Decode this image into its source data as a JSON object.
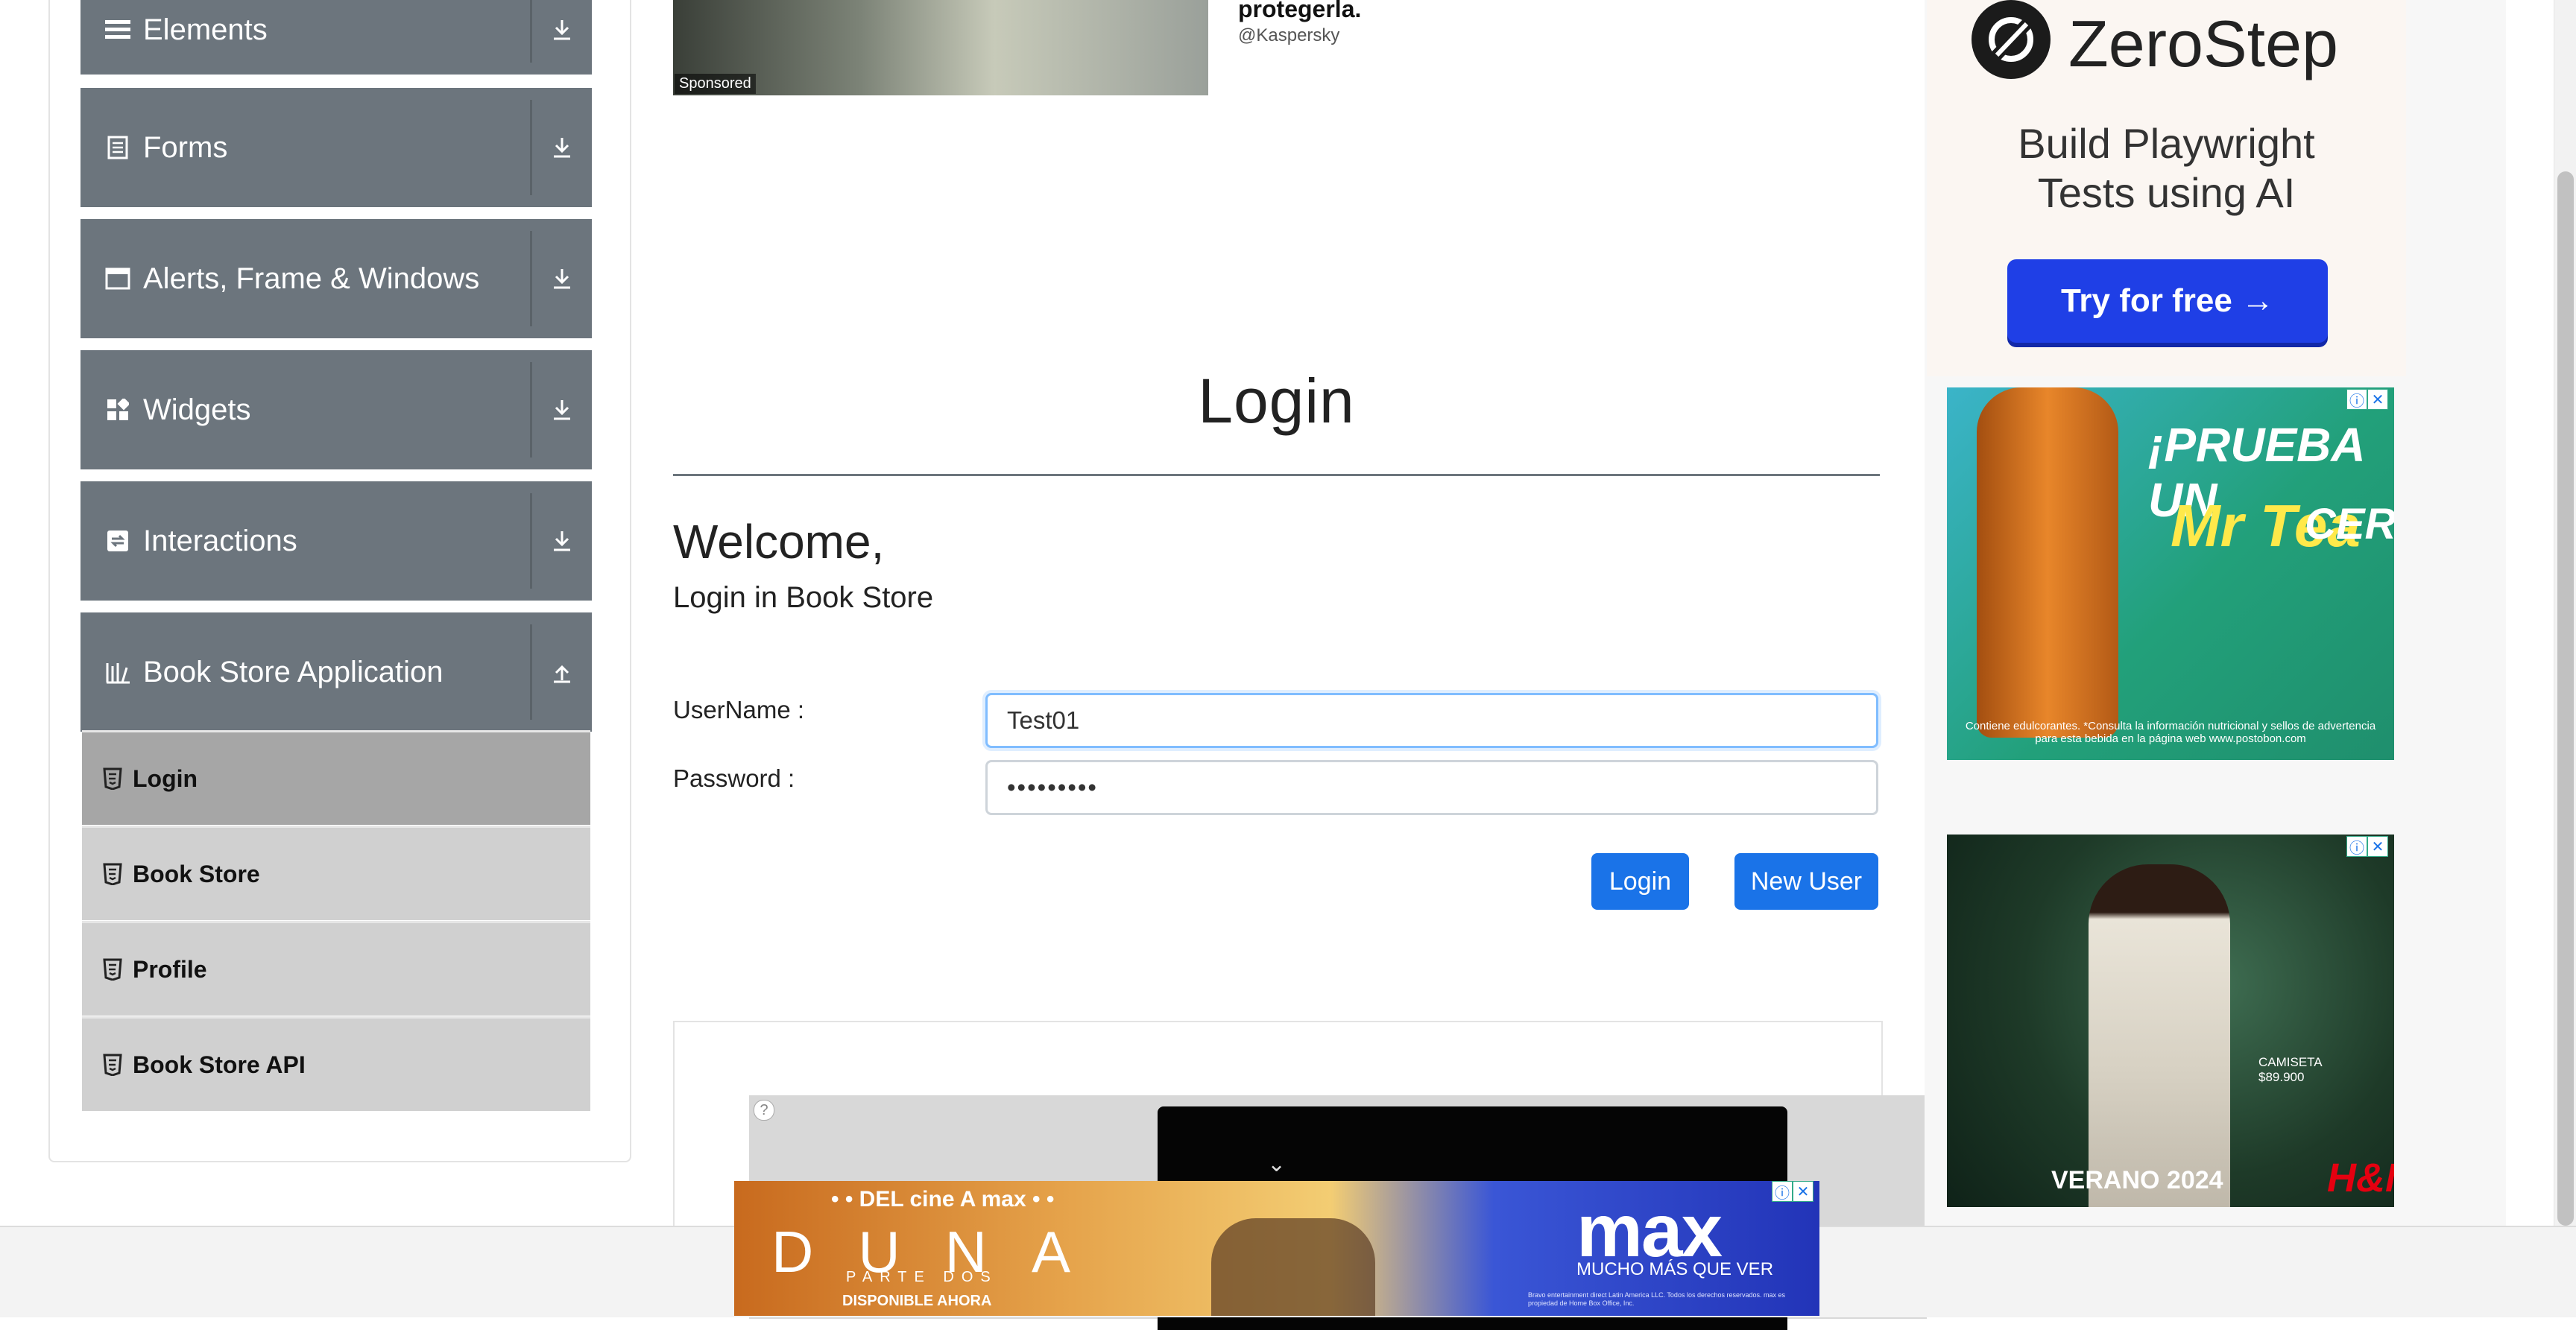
{
  "sidebar": {
    "groups": [
      {
        "label": "Elements",
        "icon": "hamburger-icon",
        "arrow": "download-arrow-icon"
      },
      {
        "label": "Forms",
        "icon": "document-icon",
        "arrow": "download-arrow-icon"
      },
      {
        "label": "Alerts, Frame & Windows",
        "icon": "window-icon",
        "arrow": "download-arrow-icon"
      },
      {
        "label": "Widgets",
        "icon": "widgets-icon",
        "arrow": "download-arrow-icon"
      },
      {
        "label": "Interactions",
        "icon": "interactions-icon",
        "arrow": "download-arrow-icon"
      },
      {
        "label": "Book Store Application",
        "icon": "books-icon",
        "arrow": "upload-arrow-icon",
        "expanded": true
      }
    ],
    "items": [
      {
        "label": "Login",
        "active": true
      },
      {
        "label": "Book Store"
      },
      {
        "label": "Profile"
      },
      {
        "label": "Book Store API"
      }
    ]
  },
  "sponsored": {
    "tag": "Sponsored",
    "title": "protegerla.",
    "handle": "@Kaspersky"
  },
  "main": {
    "page_title": "Login",
    "welcome": "Welcome,",
    "subtitle": "Login in Book Store",
    "username_label": "UserName :",
    "username_value": "Test01",
    "password_label": "Password :",
    "password_value": "•••••••••",
    "login_button": "Login",
    "new_user_button": "New User"
  },
  "ads": {
    "zerostep": {
      "name": "ZeroStep",
      "tagline_line1": "Build Playwright",
      "tagline_line2": "Tests using AI",
      "cta": "Try for free →"
    },
    "tea": {
      "headline": "¡PRUEBA UN",
      "brand": "Mr Tea",
      "cero": "CERO",
      "fine": "Contiene edulcorantes. *Consulta la información nutricional y sellos de advertencia para esta bebida en la página web www.postobon.com"
    },
    "hm": {
      "camiseta": "CAMISETA",
      "price": "$89.900",
      "verano": "VERANO 2024",
      "brand": "H&M"
    },
    "banner": {
      "cine": "• • DEL cine A max • •",
      "duna": "DUNA",
      "parte": "PARTE DOS",
      "disponible": "DISPONIBLE AHORA",
      "max": "max",
      "mucho": "MUCHO MÁS QUE VER",
      "fine": "Bravo entertainment direct Latin America LLC. Todos los derechos reservados. max es propiedad de Home Box Office, Inc."
    }
  },
  "colors": {
    "sidebar_header": "#6c757d",
    "sidebar_item": "#d0d0d0",
    "sidebar_item_active": "#a6a6a6",
    "primary_button": "#1a73e8",
    "input_focus_border": "#80bdff"
  }
}
